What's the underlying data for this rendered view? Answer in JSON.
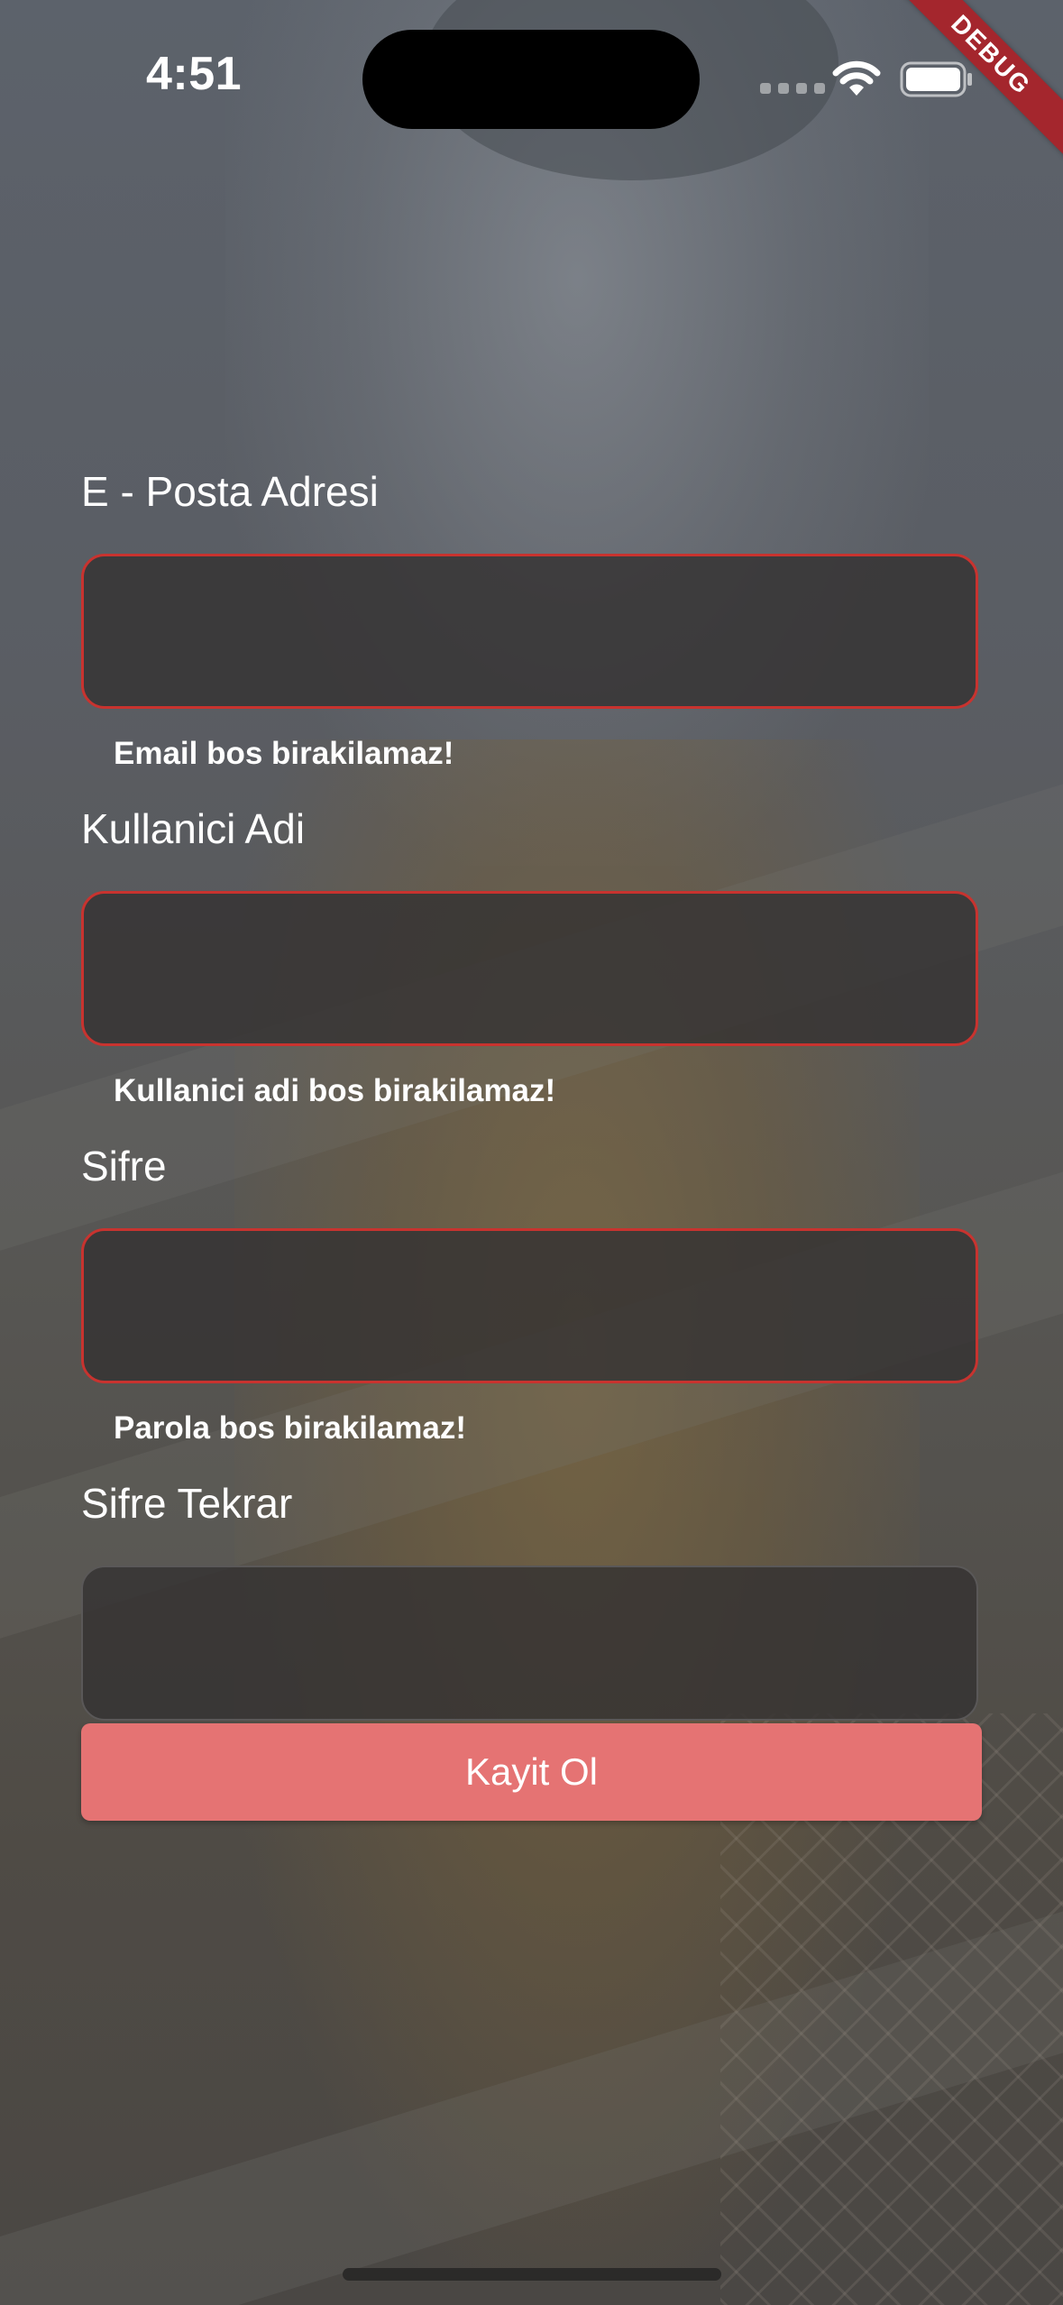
{
  "status_bar": {
    "time": "4:51"
  },
  "debug_banner": "DEBUG",
  "form": {
    "fields": [
      {
        "label": "E - Posta Adresi",
        "value": "",
        "error": "Email bos birakilamaz!"
      },
      {
        "label": "Kullanici Adi",
        "value": "",
        "error": "Kullanici adi bos birakilamaz!"
      },
      {
        "label": "Sifre",
        "value": "",
        "error": "Parola bos birakilamaz!"
      },
      {
        "label": "Sifre Tekrar",
        "value": "",
        "error": ""
      }
    ],
    "submit_label": "Kayit Ol"
  },
  "colors": {
    "error_border": "#c8332f",
    "button": "#e57373",
    "debug_ribbon": "#a4262d"
  }
}
